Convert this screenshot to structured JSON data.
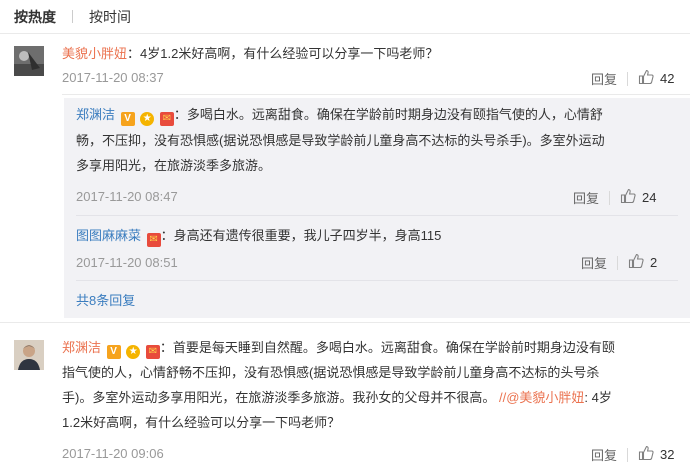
{
  "sort": {
    "hot": "按热度",
    "time": "按时间"
  },
  "comments": [
    {
      "user": "美貌小胖妞",
      "text": "：4岁1.2米好高啊，有什么经验可以分享一下吗老师？",
      "time": "2017-11-20 08:37",
      "reply_label": "回复",
      "likes": "42"
    },
    {
      "user": "郑渊洁",
      "lines": [
        "：多喝白水。远离甜食。确保在学龄前时期身边没有颐指气使的人，心情舒",
        "畅，不压抑，没有恐惧感(据说恐惧感是导致学龄前儿童身高不达标的头号杀手)。多室外运动",
        "多享用阳光，在旅游淡季多旅游。"
      ],
      "time": "2017-11-20 08:47",
      "reply_label": "回复",
      "likes": "24"
    },
    {
      "user": "图图麻麻菜",
      "text": "：身高还有遗传很重要，我儿子四岁半，身高115",
      "time": "2017-11-20 08:51",
      "reply_label": "回复",
      "likes": "2"
    },
    {
      "user": "郑渊洁",
      "lines": [
        "：首要是每天睡到自然醒。多喝白水。远离甜食。确保在学龄前时期身边没有颐",
        "指气使的人，心情舒畅不压抑，没有恐惧感(据说恐惧感是导致学龄前儿童身高不达标的头号杀",
        "手)。多室外运动多享用阳光，在旅游淡季多旅游。我孙女的父母并不很高。",
        "1.2米好高啊，有什么经验可以分享一下吗老师？"
      ],
      "quote_prefix": "//@美貌小胖妞",
      "quote_text": ": 4岁",
      "time": "2017-11-20 09:06",
      "reply_label": "回复",
      "likes": "32"
    }
  ],
  "more_replies": "共8条回复",
  "badges": {
    "v": "V"
  },
  "colors": {
    "link": "#eb7350",
    "blue": "#3b7dbf",
    "muted": "#999999",
    "reply_bg": "#f2f2f5"
  },
  "icons": [
    "thumb-up-icon",
    "vip-v-icon",
    "gold-medal-icon",
    "red-envelope-icon"
  ]
}
